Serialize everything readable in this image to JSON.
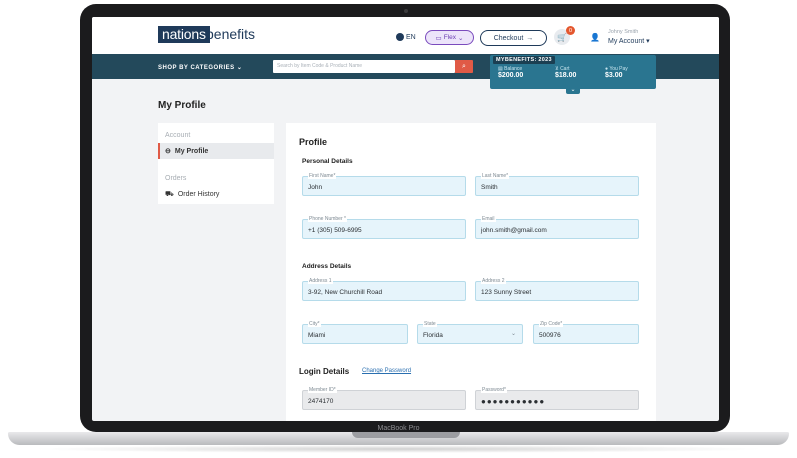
{
  "device_label": "MacBook Pro",
  "header": {
    "logo_primary": "nations",
    "logo_secondary": "benefits",
    "language": "EN",
    "flex_label": "Flex",
    "checkout_label": "Checkout",
    "cart_count": "0",
    "user_name": "Johny Smith",
    "account_label": "My Account"
  },
  "nav": {
    "shop_label": "SHOP BY CATEGORIES",
    "search_placeholder": "Search by Item Code & Product Name"
  },
  "benefits": {
    "title": "MYBENEFITS: 2023",
    "balance_label": "Balance",
    "balance_value": "$200.00",
    "cart_label": "Cart",
    "cart_value": "$18.00",
    "you_pay_label": "You Pay",
    "you_pay_value": "$3.00"
  },
  "page_title": "My Profile",
  "sidebar": {
    "account_heading": "Account",
    "my_profile": "My Profile",
    "orders_heading": "Orders",
    "order_history": "Order History"
  },
  "profile": {
    "heading": "Profile",
    "personal_heading": "Personal Details",
    "first_name_label": "First Name*",
    "first_name": "John",
    "last_name_label": "Last Name*",
    "last_name": "Smith",
    "phone_label": "Phone Number *",
    "phone": "+1 (305) 509-6995",
    "email_label": "Email",
    "email": "john.smith@gmail.com",
    "address_heading": "Address Details",
    "address1_label": "Address 1",
    "address1": "3-92, New Churchill Road",
    "address2_label": "Address 2",
    "address2": "123 Sunny Street",
    "city_label": "City*",
    "city": "Miami",
    "state_label": "State",
    "state": "Florida",
    "zip_label": "Zip Code*",
    "zip": "500976",
    "login_heading": "Login Details",
    "change_password": "Change Password",
    "member_id_label": "Member ID*",
    "member_id": "2474170",
    "password_label": "Password*",
    "password": "●●●●●●●●●●●"
  },
  "colors": {
    "nav_bg": "#23495b",
    "benefits_bg": "#2a7590",
    "accent": "#e05a46",
    "field_bg": "#e6f4fb"
  }
}
